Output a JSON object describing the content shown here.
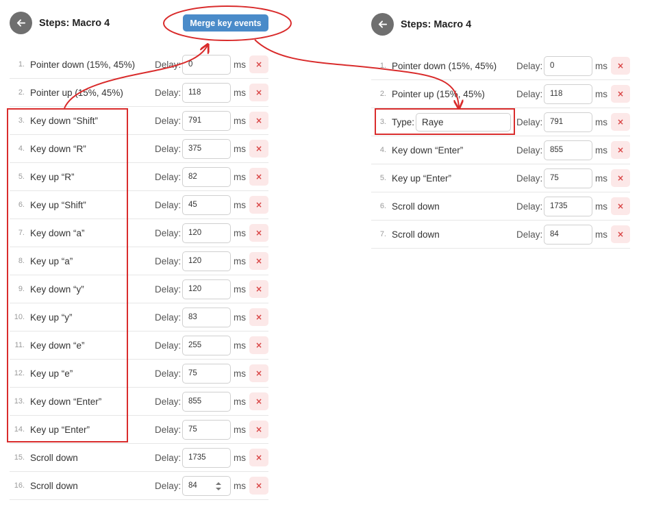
{
  "left_panel": {
    "title": "Steps: Macro 4",
    "merge_button_label": "Merge key events",
    "steps": [
      {
        "num": "1.",
        "label": "Pointer down (15%, 45%)",
        "delay": "0"
      },
      {
        "num": "2.",
        "label": "Pointer up (15%, 45%)",
        "delay": "118"
      },
      {
        "num": "3.",
        "label": "Key down “Shift”",
        "delay": "791"
      },
      {
        "num": "4.",
        "label": "Key down “R”",
        "delay": "375"
      },
      {
        "num": "5.",
        "label": "Key up “R”",
        "delay": "82"
      },
      {
        "num": "6.",
        "label": "Key up “Shift”",
        "delay": "45"
      },
      {
        "num": "7.",
        "label": "Key down “a”",
        "delay": "120"
      },
      {
        "num": "8.",
        "label": "Key up “a”",
        "delay": "120"
      },
      {
        "num": "9.",
        "label": "Key down “y”",
        "delay": "120"
      },
      {
        "num": "10.",
        "label": "Key up “y”",
        "delay": "83"
      },
      {
        "num": "11.",
        "label": "Key down “e”",
        "delay": "255"
      },
      {
        "num": "12.",
        "label": "Key up “e”",
        "delay": "75"
      },
      {
        "num": "13.",
        "label": "Key down “Enter”",
        "delay": "855"
      },
      {
        "num": "14.",
        "label": "Key up “Enter”",
        "delay": "75"
      },
      {
        "num": "15.",
        "label": "Scroll down",
        "delay": "1735"
      },
      {
        "num": "16.",
        "label": "Scroll down",
        "delay": "84"
      }
    ]
  },
  "right_panel": {
    "title": "Steps: Macro 4",
    "steps": [
      {
        "num": "1.",
        "label": "Pointer down (15%, 45%)",
        "delay": "0"
      },
      {
        "num": "2.",
        "label": "Pointer up (15%, 45%)",
        "delay": "118"
      },
      {
        "num": "3.",
        "type_label": "Type:",
        "type_value": "Raye",
        "delay": "791"
      },
      {
        "num": "4.",
        "label": "Key down “Enter”",
        "delay": "855"
      },
      {
        "num": "5.",
        "label": "Key up “Enter”",
        "delay": "75"
      },
      {
        "num": "6.",
        "label": "Scroll down",
        "delay": "1735"
      },
      {
        "num": "7.",
        "label": "Scroll down",
        "delay": "84"
      }
    ]
  },
  "common": {
    "delay_label": "Delay:",
    "ms_label": "ms",
    "remove_glyph": "×"
  },
  "icons": {
    "back": "arrow-left-icon",
    "remove": "close-icon",
    "spinner": "number-spinner-icon"
  },
  "colors": {
    "annotation": "#d92b2b",
    "merge_button": "#4a8bc9",
    "back_button": "#6f6f6f",
    "remove_bg": "#fce8e8",
    "remove_fg": "#d94545"
  }
}
